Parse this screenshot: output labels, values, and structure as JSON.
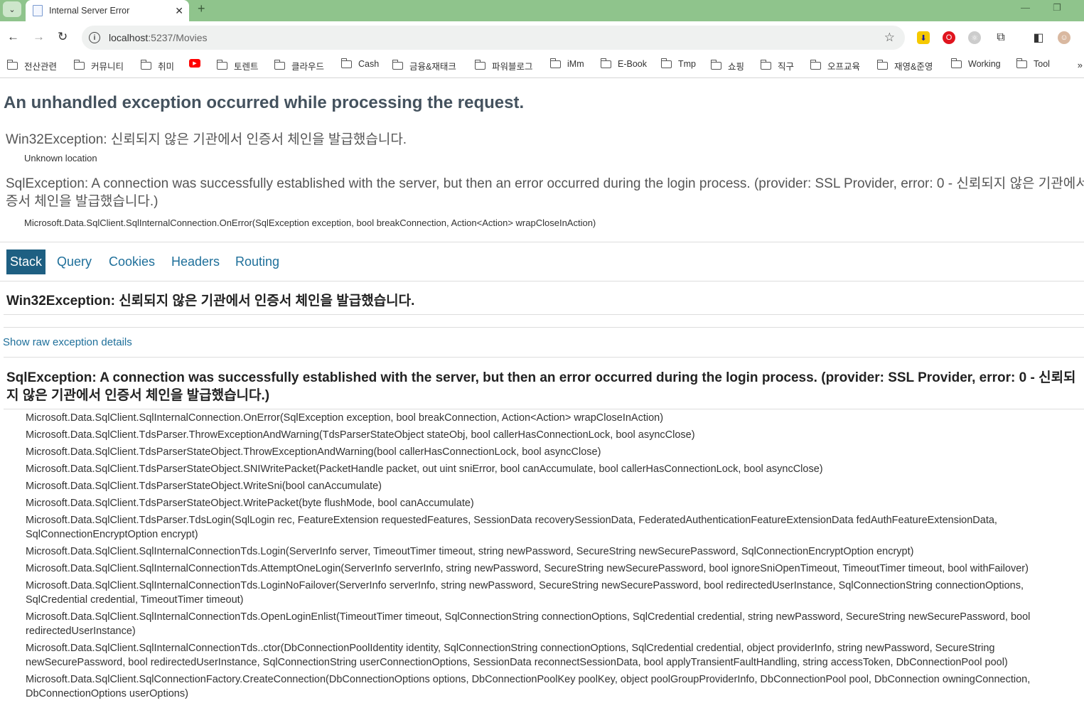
{
  "browser": {
    "tab_title": "Internal Server Error",
    "url_host": "localhost",
    "url_rest": ":5237/Movies",
    "bookmarks": [
      "전산관련",
      "커뮤니티",
      "취미",
      "토렌트",
      "클라우드",
      "Cash",
      "금융&재태크",
      "파워블로그",
      "iMm",
      "E-Book",
      "Tmp",
      "쇼핑",
      "직구",
      "오프교육",
      "재영&준영",
      "Working",
      "Tool"
    ]
  },
  "page": {
    "title": "An unhandled exception occurred while processing the request.",
    "error1": "Win32Exception: 신뢰되지 않은 기관에서 인증서 체인을 발급했습니다.",
    "error1_location": "Unknown location",
    "error2_line1": "SqlException: A connection was successfully established with the server, but then an error occurred during the login process. (provider: SSL Provider, error: 0 - 신뢰되지 않은 기관에서 인",
    "error2_line2": "증서 체인을 발급했습니다.)",
    "error2_location": "Microsoft.Data.SqlClient.SqlInternalConnection.OnError(SqlException exception, bool breakConnection, Action<Action> wrapCloseInAction)",
    "tabs": [
      "Stack",
      "Query",
      "Cookies",
      "Headers",
      "Routing"
    ],
    "stack_h1": "Win32Exception: 신뢰되지 않은 기관에서 인증서 체인을 발급했습니다.",
    "raw_link": "Show raw exception details",
    "stack_h2": "SqlException: A connection was successfully established with the server, but then an error occurred during the login process. (provider: SSL Provider, error: 0 - 신뢰되지 않은 기관에서 인증서 체인을 발급했습니다.)",
    "frames": [
      "Microsoft.Data.SqlClient.SqlInternalConnection.OnError(SqlException exception, bool breakConnection, Action<Action> wrapCloseInAction)",
      "Microsoft.Data.SqlClient.TdsParser.ThrowExceptionAndWarning(TdsParserStateObject stateObj, bool callerHasConnectionLock, bool asyncClose)",
      "Microsoft.Data.SqlClient.TdsParserStateObject.ThrowExceptionAndWarning(bool callerHasConnectionLock, bool asyncClose)",
      "Microsoft.Data.SqlClient.TdsParserStateObject.SNIWritePacket(PacketHandle packet, out uint sniError, bool canAccumulate, bool callerHasConnectionLock, bool asyncClose)",
      "Microsoft.Data.SqlClient.TdsParserStateObject.WriteSni(bool canAccumulate)",
      "Microsoft.Data.SqlClient.TdsParserStateObject.WritePacket(byte flushMode, bool canAccumulate)",
      "Microsoft.Data.SqlClient.TdsParser.TdsLogin(SqlLogin rec, FeatureExtension requestedFeatures, SessionData recoverySessionData, FederatedAuthenticationFeatureExtensionData fedAuthFeatureExtensionData, SqlConnectionEncryptOption encrypt)",
      "Microsoft.Data.SqlClient.SqlInternalConnectionTds.Login(ServerInfo server, TimeoutTimer timeout, string newPassword, SecureString newSecurePassword, SqlConnectionEncryptOption encrypt)",
      "Microsoft.Data.SqlClient.SqlInternalConnectionTds.AttemptOneLogin(ServerInfo serverInfo, string newPassword, SecureString newSecurePassword, bool ignoreSniOpenTimeout, TimeoutTimer timeout, bool withFailover)",
      "Microsoft.Data.SqlClient.SqlInternalConnectionTds.LoginNoFailover(ServerInfo serverInfo, string newPassword, SecureString newSecurePassword, bool redirectedUserInstance, SqlConnectionString connectionOptions, SqlCredential credential, TimeoutTimer timeout)",
      "Microsoft.Data.SqlClient.SqlInternalConnectionTds.OpenLoginEnlist(TimeoutTimer timeout, SqlConnectionString connectionOptions, SqlCredential credential, string newPassword, SecureString newSecurePassword, bool redirectedUserInstance)",
      "Microsoft.Data.SqlClient.SqlInternalConnectionTds..ctor(DbConnectionPoolIdentity identity, SqlConnectionString connectionOptions, SqlCredential credential, object providerInfo, string newPassword, SecureString newSecurePassword, bool redirectedUserInstance, SqlConnectionString userConnectionOptions, SessionData reconnectSessionData, bool applyTransientFaultHandling, string accessToken, DbConnectionPool pool)",
      "Microsoft.Data.SqlClient.SqlConnectionFactory.CreateConnection(DbConnectionOptions options, DbConnectionPoolKey poolKey, object poolGroupProviderInfo, DbConnectionPool pool, DbConnection owningConnection, DbConnectionOptions userOptions)"
    ]
  },
  "colors": {
    "tabbar": "#8fc48c",
    "link": "#1e6f9a",
    "active_tab": "#1e5f82",
    "title": "#44525e"
  }
}
